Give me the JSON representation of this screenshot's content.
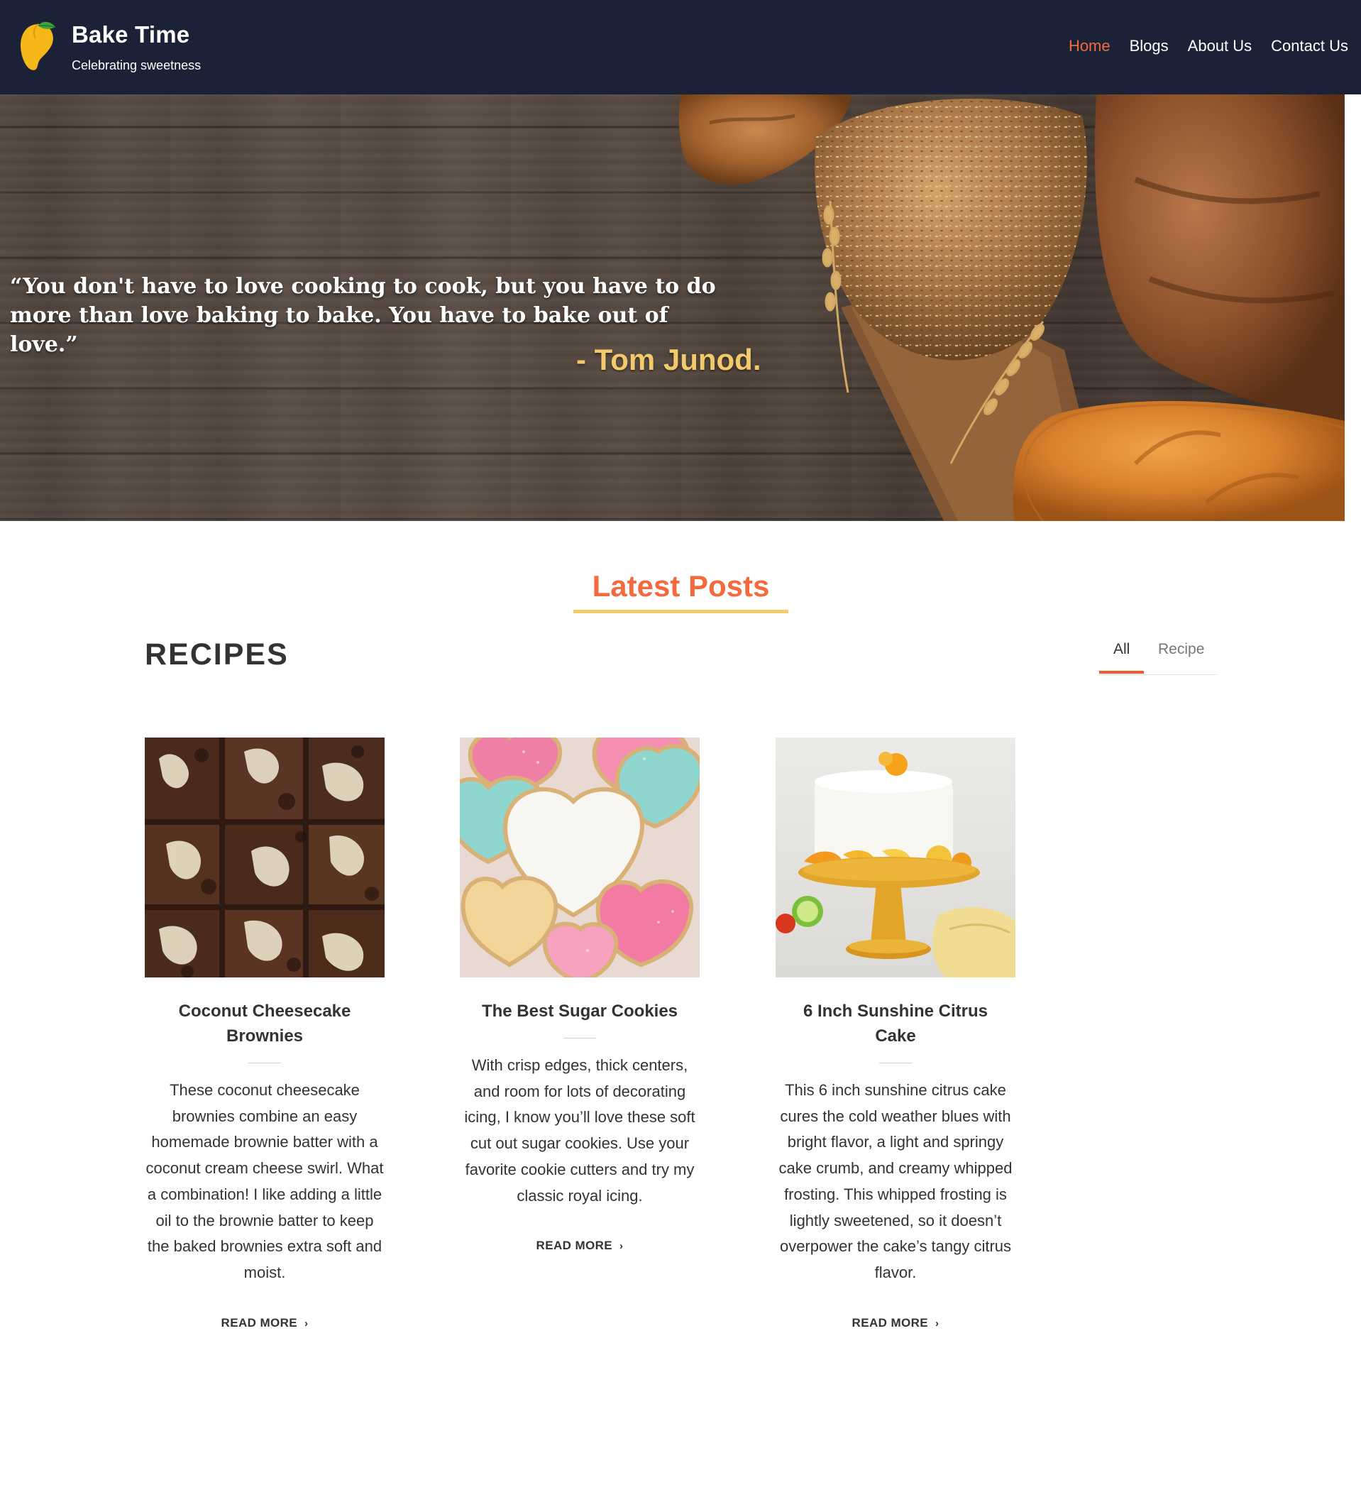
{
  "header": {
    "brand_title": "Bake Time",
    "brand_tagline": "Celebrating sweetness",
    "logo_icon": "mango-icon",
    "nav": [
      {
        "label": "Home",
        "active": true
      },
      {
        "label": "Blogs",
        "active": false
      },
      {
        "label": "About Us",
        "active": false
      },
      {
        "label": "Contact Us",
        "active": false
      }
    ]
  },
  "hero": {
    "quote": "“You don't have to love cooking to cook, but you have to do more than love baking to bake. You have to bake out of love.”",
    "author": "- Tom Junod."
  },
  "posts": {
    "section_title": "Latest Posts",
    "category_heading": "RECIPES",
    "filters": [
      {
        "label": "All",
        "active": true
      },
      {
        "label": "Recipe",
        "active": false
      }
    ],
    "cards": [
      {
        "title": "Coconut Cheesecake Brownies",
        "description": "These coconut cheesecake brownies combine an easy homemade brownie batter with a coconut cream cheese swirl. What a combination! I like adding a little oil to the brownie batter to keep the baked brownies extra soft and moist.",
        "read_more": "READ MORE",
        "image": "brownies-photo"
      },
      {
        "title": "The Best Sugar Cookies",
        "description": "With crisp edges, thick centers, and room for lots of decorating icing, I know you’ll love these soft cut out sugar cookies. Use your favorite cookie cutters and try my classic royal icing.",
        "read_more": "READ MORE",
        "image": "sugar-cookies-photo"
      },
      {
        "title": "6 Inch Sunshine Citrus Cake",
        "description": "This 6 inch sunshine citrus cake cures the cold weather blues with bright flavor, a light and springy cake crumb, and creamy whipped frosting. This whipped frosting is lightly sweetened, so it doesn’t overpower the cake’s tangy citrus flavor.",
        "read_more": "READ MORE",
        "image": "citrus-cake-photo"
      }
    ]
  },
  "colors": {
    "header_bg": "#1b2136",
    "accent": "#f26a3d",
    "underline": "#f2cf6b",
    "author": "#f2c96b",
    "text": "#333333"
  }
}
